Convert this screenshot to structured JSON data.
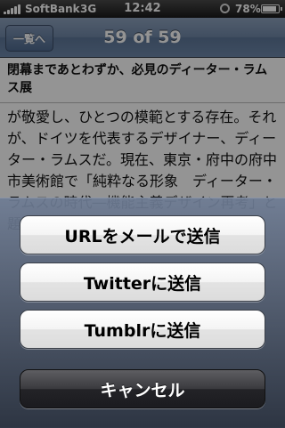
{
  "status_bar": {
    "carrier": "SoftBank",
    "network": "3G",
    "time": "12:42",
    "battery_percent": "78%",
    "battery_level": 0.78,
    "icons": [
      "signal-icon",
      "rotation-lock-icon",
      "battery-icon"
    ]
  },
  "nav": {
    "back_label": "一覧へ",
    "title": "59 of 59"
  },
  "article": {
    "title": "閉幕まであとわずか、必見のディーター・ラムス展",
    "body": "が敬愛し、ひとつの模範とする存在。それが、ドイツを代表するデザイナー、ディーター・ラムスだ。現在、東京・府中の府中市美術館で「純粋なる形象　ディーター・ラムスの時代―機能主義デザイン再考」と題した大規模な展覧会が行われている。"
  },
  "action_sheet": {
    "buttons": [
      {
        "label": "URLをメールで送信"
      },
      {
        "label": "Twitterに送信"
      },
      {
        "label": "Tumblrに送信"
      }
    ],
    "cancel_label": "キャンセル"
  },
  "colors": {
    "nav_bar": "#6e86a6",
    "sheet": "#5a667a",
    "cancel_button": "#2a2a2e"
  }
}
